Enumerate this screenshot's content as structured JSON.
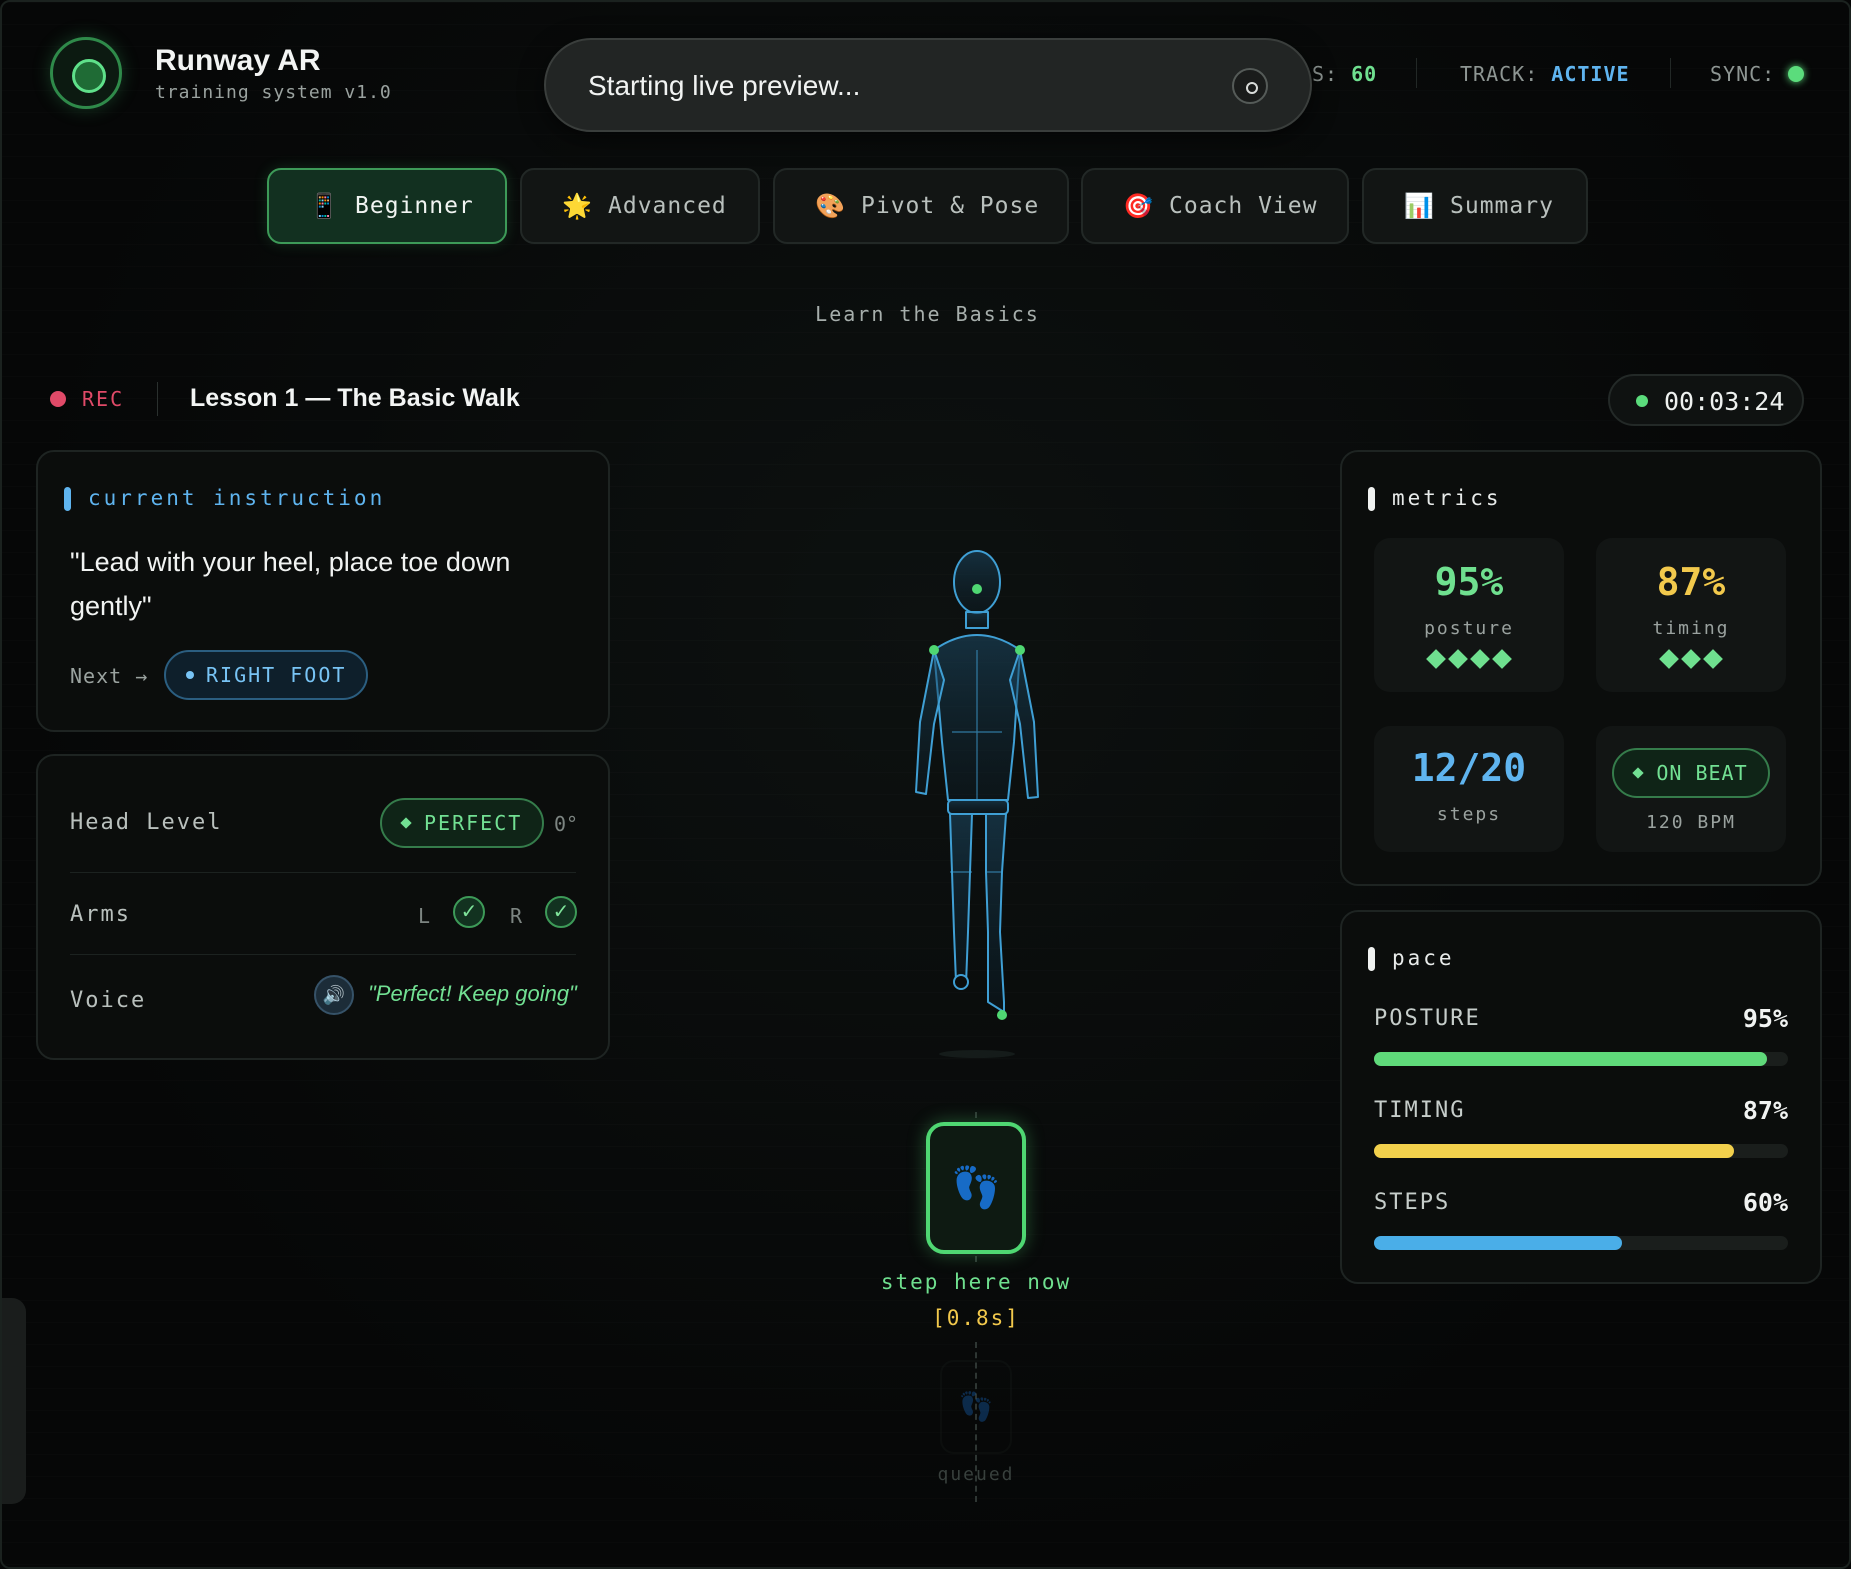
{
  "app": {
    "title": "Runway AR",
    "subtitle": "training system v1.0"
  },
  "toast": {
    "text": "Starting live preview..."
  },
  "status": {
    "fps_label": "S:",
    "fps_value": "60",
    "track_label": "TRACK:",
    "track_value": "ACTIVE",
    "sync_label": "SYNC:"
  },
  "tabs": [
    {
      "icon": "📱",
      "label": "Beginner",
      "active": true
    },
    {
      "icon": "🌟",
      "label": "Advanced"
    },
    {
      "icon": "🎨",
      "label": "Pivot & Pose"
    },
    {
      "icon": "🎯",
      "label": "Coach View"
    },
    {
      "icon": "📊",
      "label": "Summary"
    }
  ],
  "section_subtitle": "Learn the Basics",
  "recording": {
    "label": "REC",
    "lesson": "Lesson 1 — The Basic Walk",
    "timer": "00:03:24"
  },
  "instruction": {
    "heading": "current instruction",
    "text": "\"Lead with your heel, place toe down gently\"",
    "next_label": "Next →",
    "next_value": "RIGHT FOOT"
  },
  "checks": {
    "head_label": "Head Level",
    "head_status": "PERFECT",
    "head_angle": "0°",
    "arms_label": "Arms",
    "arm_left": "L",
    "arm_right": "R",
    "check_mark": "✓",
    "voice_label": "Voice",
    "voice_icon": "🔊",
    "voice_text": "\"Perfect! Keep going\""
  },
  "metrics": {
    "heading": "metrics",
    "posture": {
      "value": "95%",
      "label": "posture",
      "rating": 4
    },
    "timing": {
      "value": "87%",
      "label": "timing",
      "rating": 3
    },
    "steps": {
      "value": "12/20",
      "label": "steps"
    },
    "beat": {
      "status": "ON BEAT",
      "bpm": "120 BPM"
    }
  },
  "pace": {
    "heading": "pace",
    "bars": [
      {
        "label": "POSTURE",
        "value_text": "95%",
        "value": 0.95,
        "color": "#5fd97a"
      },
      {
        "label": "TIMING",
        "value_text": "87%",
        "value": 0.87,
        "color": "#f2d04c"
      },
      {
        "label": "STEPS",
        "value_text": "60%",
        "value": 0.6,
        "color": "#4aaee8"
      }
    ]
  },
  "stage": {
    "step_icon": "👣",
    "step_now": "step here now",
    "step_time": "[0.8s]",
    "queued_label": "queued"
  },
  "colors": {
    "accent_green": "#5bdc7c",
    "accent_blue": "#5fb4ef",
    "accent_yellow": "#f2c94c",
    "rec_red": "#e04a68"
  }
}
